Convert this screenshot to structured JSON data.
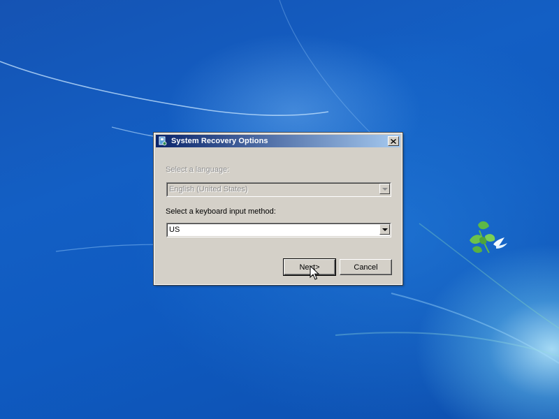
{
  "dialog": {
    "title": "System Recovery Options",
    "language_label": "Select a language:",
    "language_value": "English (United States)",
    "keyboard_label": "Select a keyboard input method:",
    "keyboard_value": "US",
    "next_label": "Next>",
    "cancel_label": "Cancel"
  },
  "icons": {
    "window_icon": "recovery-window-icon",
    "close": "close-icon",
    "dropdown": "chevron-down-icon",
    "cursor": "mouse-pointer-icon",
    "bird": "bird-icon",
    "plant": "plant-icon"
  },
  "colors": {
    "desktop_blue": "#135fc4",
    "dialog_face": "#d4d0c8",
    "titlebar_start": "#0a246a",
    "titlebar_end": "#a6caf0"
  }
}
